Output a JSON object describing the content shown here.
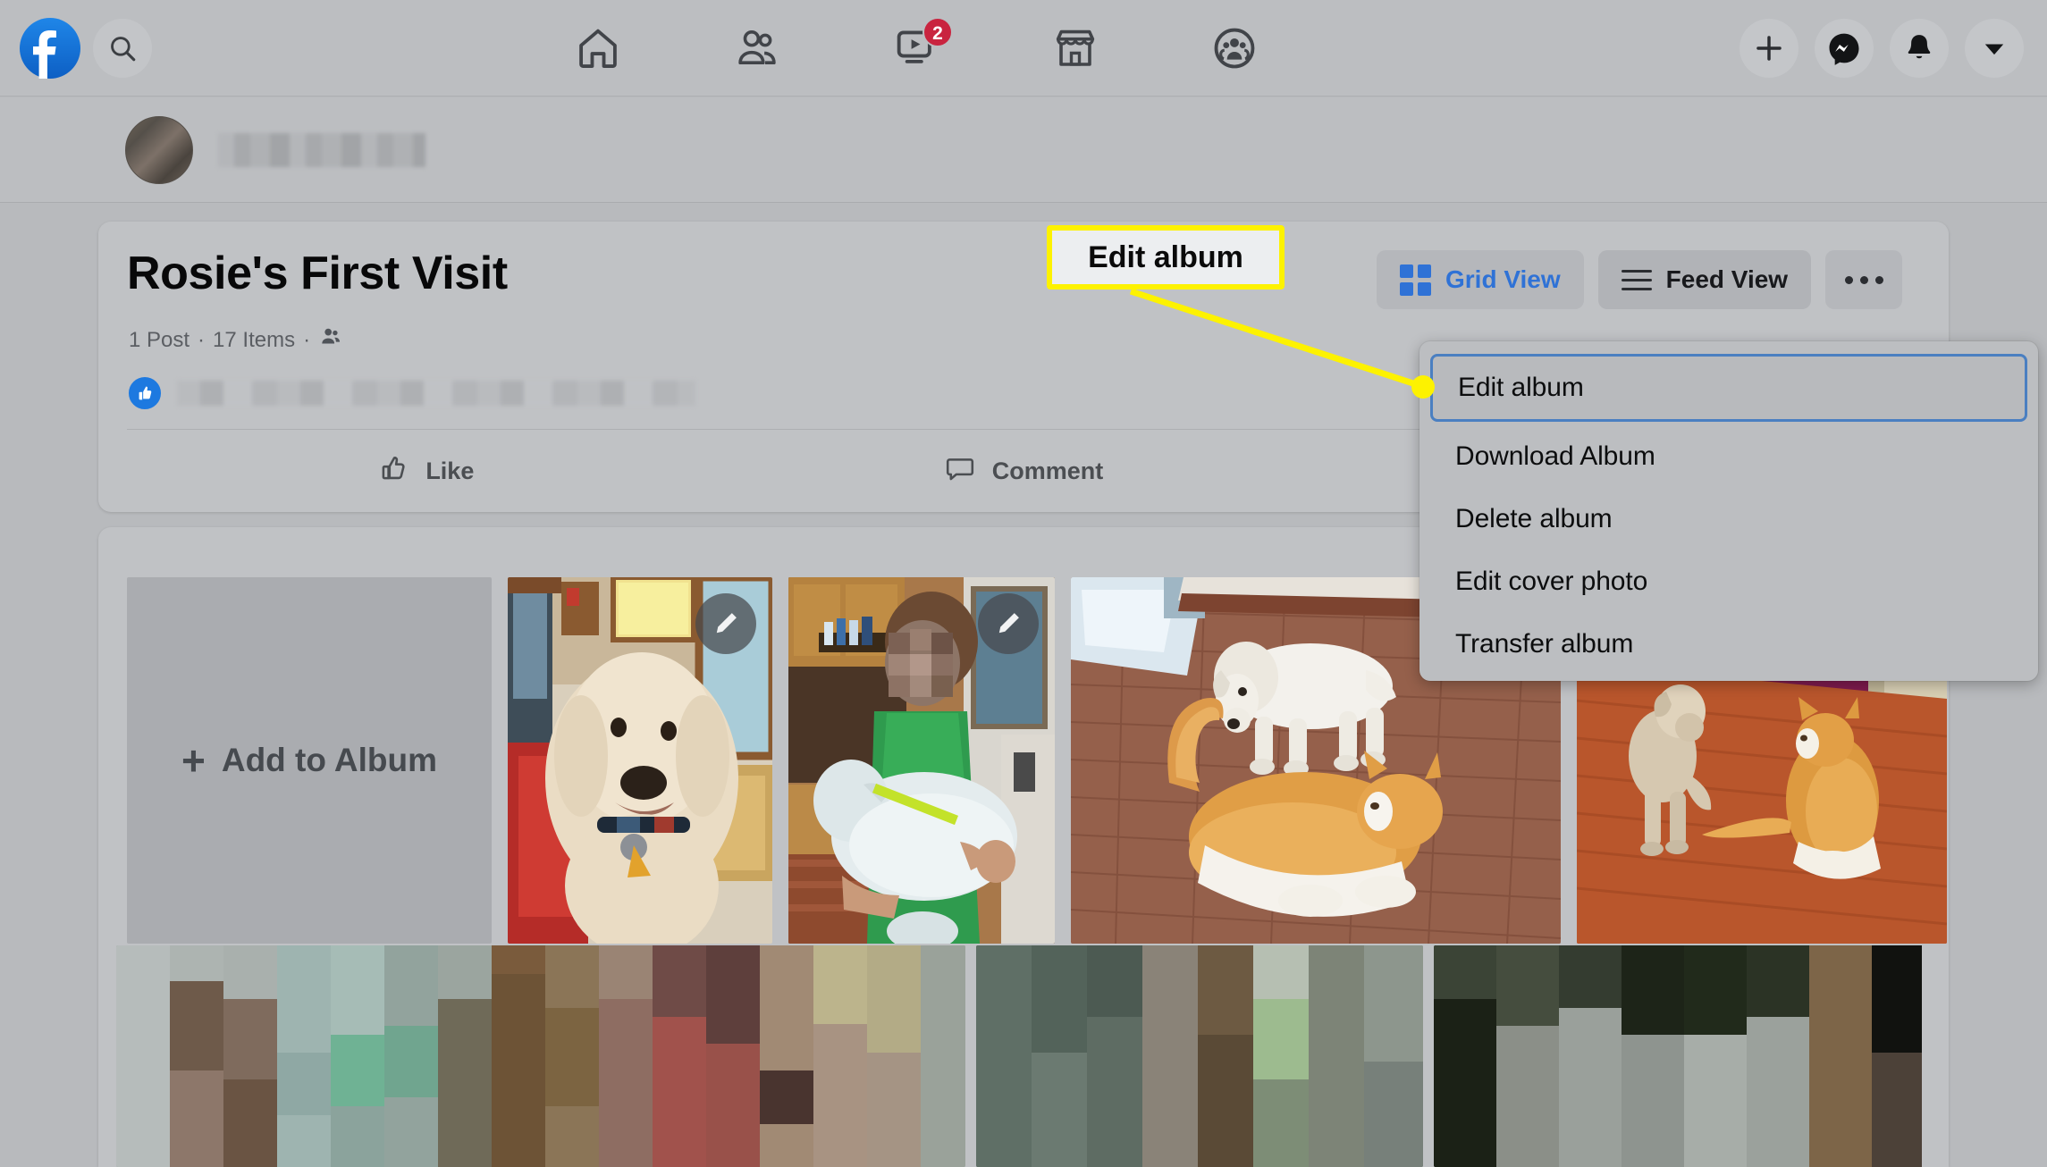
{
  "topnav": {
    "logo_label": "Facebook",
    "search_placeholder": "Search Facebook",
    "tabs": [
      {
        "name": "home",
        "icon": "home-icon",
        "badge": ""
      },
      {
        "name": "friends",
        "icon": "friends-icon",
        "badge": ""
      },
      {
        "name": "watch",
        "icon": "watch-video-icon",
        "badge": "2"
      },
      {
        "name": "marketplace",
        "icon": "marketplace-store-icon",
        "badge": ""
      },
      {
        "name": "groups",
        "icon": "groups-icon",
        "badge": ""
      }
    ],
    "actions": [
      {
        "name": "create",
        "icon": "plus-icon"
      },
      {
        "name": "messenger",
        "icon": "messenger-icon"
      },
      {
        "name": "notifications",
        "icon": "bell-icon"
      },
      {
        "name": "account",
        "icon": "chevron-down-icon"
      }
    ]
  },
  "profile_strip": {
    "avatar_alt": "profile-avatar",
    "name_redacted": true
  },
  "album": {
    "title": "Rosie's First Visit",
    "meta_posts": "1 Post",
    "meta_separator": "·",
    "meta_items": "17 Items",
    "privacy_icon": "friends-privacy-icon",
    "reaction_icon": "thumbs-up-badge",
    "reaction_text_redacted": true,
    "actions": [
      {
        "name": "like",
        "label": "Like",
        "icon": "thumbs-up-outline-icon"
      },
      {
        "name": "comment",
        "label": "Comment",
        "icon": "comment-bubble-icon"
      }
    ]
  },
  "view_controls": {
    "grid_label": "Grid View",
    "grid_icon": "grid-squares-icon",
    "grid_active": true,
    "feed_label": "Feed View",
    "feed_icon": "hamburger-list-icon",
    "more_icon": "ellipsis-horizontal-icon",
    "more_label": ""
  },
  "dropdown": {
    "items": [
      {
        "label": "Edit album",
        "selected": true
      },
      {
        "label": "Download Album",
        "selected": false
      },
      {
        "label": "Delete album",
        "selected": false
      },
      {
        "label": "Edit cover photo",
        "selected": false
      },
      {
        "label": "Transfer album",
        "selected": false
      }
    ]
  },
  "callout": {
    "text": "Edit album",
    "border_color": "#fdf200",
    "fill_color": "#eceef0"
  },
  "photo_grid": {
    "add_tile": {
      "label": "Add to Album",
      "plus": "+"
    },
    "tiles": [
      {
        "name": "photo-labradoodle-portrait",
        "edit_icon": "pencil-edit-icon",
        "has_edit": true
      },
      {
        "name": "photo-person-holding-dog",
        "edit_icon": "pencil-edit-icon",
        "has_edit": true
      },
      {
        "name": "photo-dog-and-cat-brick-floor",
        "edit_icon": "",
        "has_edit": false
      },
      {
        "name": "photo-dog-and-cat-hardwood",
        "edit_icon": "",
        "has_edit": false
      }
    ],
    "bottom_row_redacted": true
  },
  "colors": {
    "page_bg": "#b8babd",
    "card_bg": "#c0c2c5",
    "nav_bg": "#bcbec1",
    "accent_blue": "#2f72d6",
    "fb_blue": "#1877f2",
    "badge_red": "#c9243f",
    "highlight_yellow": "#fdf200",
    "selection_blue": "#4a7fc1",
    "text_primary": "#0c0d0e",
    "text_secondary": "#5b5e63"
  }
}
